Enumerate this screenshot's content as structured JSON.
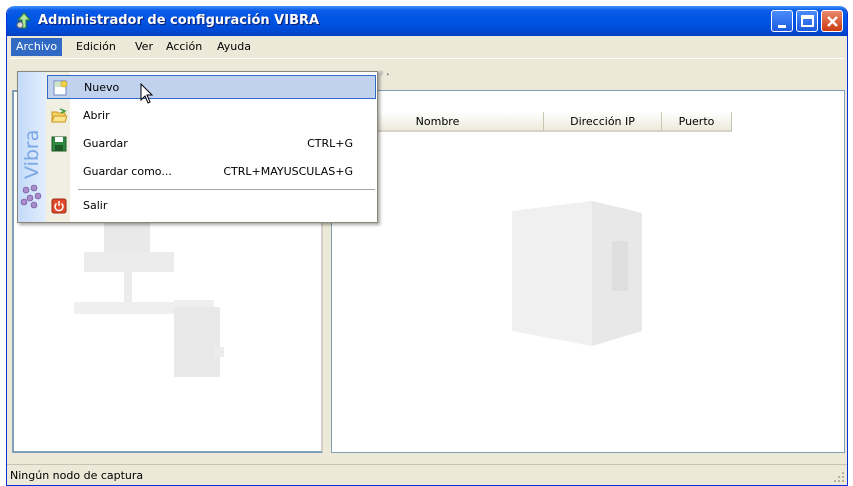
{
  "window": {
    "title": "Administrador de configuración VIBRA",
    "colors": {
      "titlebar": "#0055e5",
      "menu_highlight": "#316ac5",
      "item_hover": "#c1d2ee"
    }
  },
  "menubar": {
    "items": [
      {
        "label": "Archivo",
        "active": true
      },
      {
        "label": "Edición"
      },
      {
        "label": "Ver"
      },
      {
        "label": "Acción"
      },
      {
        "label": "Ayuda"
      }
    ]
  },
  "file_menu": {
    "side_label": "Vibra",
    "items": [
      {
        "label": "Nuevo",
        "shortcut": "",
        "icon": "new-document-icon",
        "highlighted": true
      },
      {
        "label": "Abrir",
        "shortcut": "",
        "icon": "open-folder-icon"
      },
      {
        "label": "Guardar",
        "shortcut": "CTRL+G",
        "icon": "save-disk-icon"
      },
      {
        "label": "Guardar como...",
        "shortcut": "CTRL+MAYUSCULAS+G",
        "icon": ""
      },
      {
        "label": "Salir",
        "shortcut": "",
        "icon": "power-exit-icon"
      }
    ]
  },
  "list": {
    "columns": [
      "Nombre",
      "Dirección IP",
      "Puerto"
    ],
    "rows": []
  },
  "status": {
    "text": "Ningún nodo de captura"
  }
}
